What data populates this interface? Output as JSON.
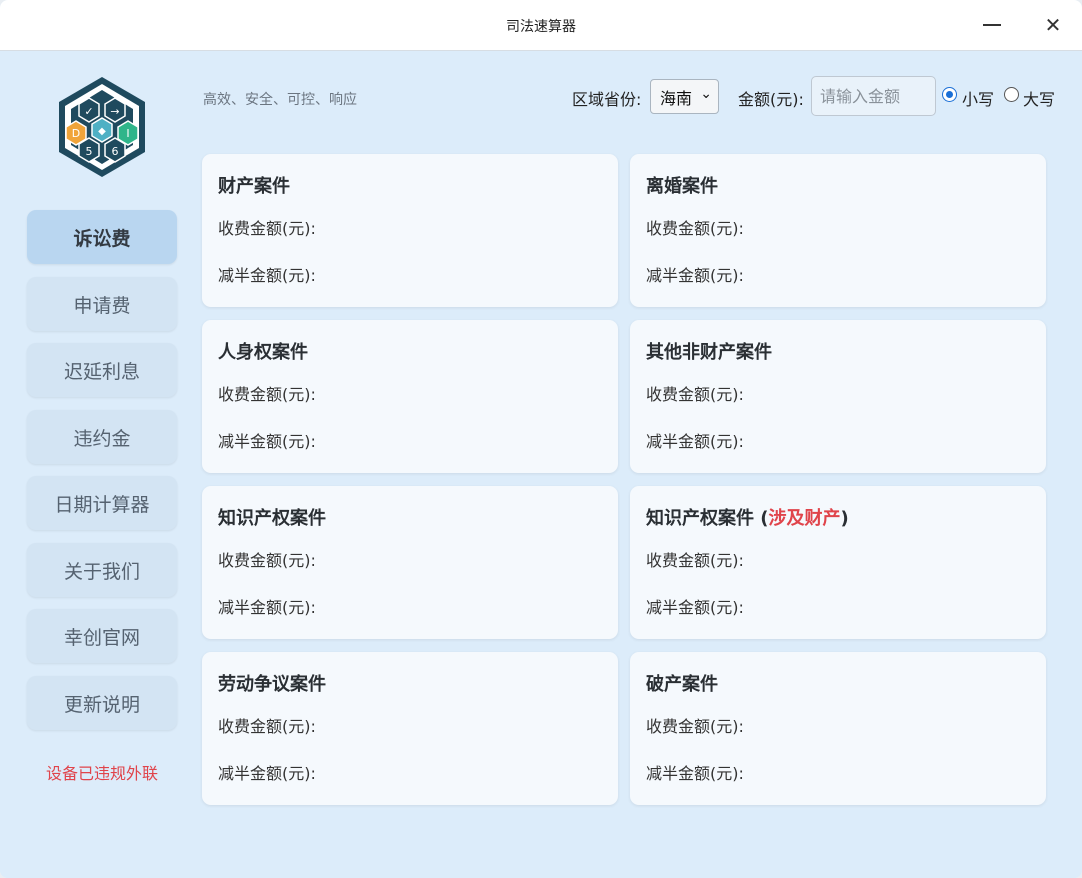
{
  "window": {
    "title": "司法速算器"
  },
  "header": {
    "slogan": "高效、安全、可控、响应",
    "region_label": "区域省份:",
    "region_value": "海南",
    "amount_label": "金额(元):",
    "amount_placeholder": "请输入金额",
    "radio_small": "小写",
    "radio_big": "大写",
    "selected_radio": "小写"
  },
  "sidebar": {
    "items": [
      {
        "label": "诉讼费",
        "active": true
      },
      {
        "label": "申请费",
        "active": false
      },
      {
        "label": "迟延利息",
        "active": false
      },
      {
        "label": "违约金",
        "active": false
      },
      {
        "label": "日期计算器",
        "active": false
      },
      {
        "label": "关于我们",
        "active": false
      },
      {
        "label": "幸创官网",
        "active": false
      },
      {
        "label": "更新说明",
        "active": false
      }
    ],
    "warning": "设备已违规外联"
  },
  "cards": [
    {
      "title": "财产案件",
      "fee_label": "收费金额(元):",
      "half_label": "减半金额(元):"
    },
    {
      "title": "离婚案件",
      "fee_label": "收费金额(元):",
      "half_label": "减半金额(元):"
    },
    {
      "title": "人身权案件",
      "fee_label": "收费金额(元):",
      "half_label": "减半金额(元):"
    },
    {
      "title": "其他非财产案件",
      "fee_label": "收费金额(元):",
      "half_label": "减半金额(元):"
    },
    {
      "title": "知识产权案件",
      "fee_label": "收费金额(元):",
      "half_label": "减半金额(元):"
    },
    {
      "title": "知识产权案件 (",
      "title_highlight": "涉及财产",
      "title_suffix": ")",
      "fee_label": "收费金额(元):",
      "half_label": "减半金额(元):"
    },
    {
      "title": "劳动争议案件",
      "fee_label": "收费金额(元):",
      "half_label": "减半金额(元):"
    },
    {
      "title": "破产案件",
      "fee_label": "收费金额(元):",
      "half_label": "减半金额(元):"
    }
  ],
  "colors": {
    "accent": "#1a6fd6",
    "warning": "#e0444b",
    "highlight": "#e0444b"
  }
}
